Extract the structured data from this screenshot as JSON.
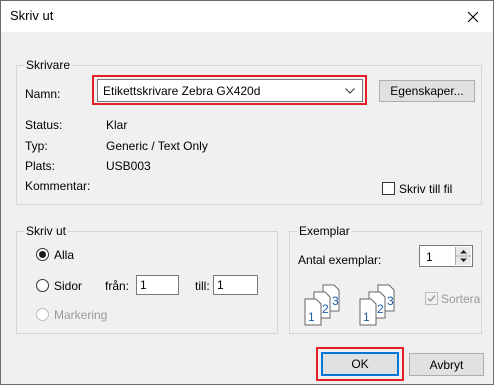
{
  "window": {
    "title": "Skriv ut"
  },
  "printer_group": {
    "legend": "Skrivare",
    "name_label": "Namn:",
    "name_value": "Etikettskrivare Zebra GX420d",
    "properties_button": "Egenskaper...",
    "status_label": "Status:",
    "status_value": "Klar",
    "type_label": "Typ:",
    "type_value": "Generic / Text Only",
    "location_label": "Plats:",
    "location_value": "USB003",
    "comment_label": "Kommentar:",
    "print_to_file_label": "Skriv till fil",
    "print_to_file_checked": false
  },
  "range_group": {
    "legend": "Skriv ut",
    "all_label": "Alla",
    "pages_label": "Sidor",
    "from_label": "från:",
    "from_value": "1",
    "to_label": "till:",
    "to_value": "1",
    "selection_label": "Markering",
    "selected": "all"
  },
  "copies_group": {
    "legend": "Exemplar",
    "count_label": "Antal exemplar:",
    "count_value": "1",
    "collate_label": "Sortera",
    "collate_checked": true,
    "collate_enabled": false,
    "page_numbers": [
      "1",
      "2",
      "3"
    ]
  },
  "buttons": {
    "ok": "OK",
    "cancel": "Avbryt"
  },
  "highlight_color": "#e31d2a"
}
